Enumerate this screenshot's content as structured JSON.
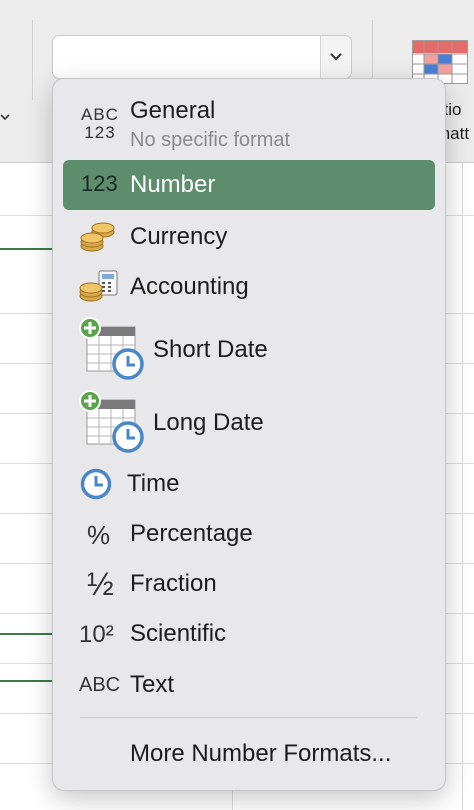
{
  "ribbon": {
    "format_combo_value": "",
    "conditional_formatting_label_line1": "litio",
    "conditional_formatting_label_line2": "matt"
  },
  "number_format_menu": {
    "items": [
      {
        "label": "General",
        "sub": "No specific format",
        "icon": "abc-123-icon",
        "icon_text": "ABC\n123"
      },
      {
        "label": "Number",
        "icon": "number-123-icon",
        "icon_text": "123",
        "selected": true
      },
      {
        "label": "Currency",
        "icon": "coins-icon"
      },
      {
        "label": "Accounting",
        "icon": "coins-calculator-icon"
      },
      {
        "label": "Short Date",
        "icon": "calendar-clock-icon"
      },
      {
        "label": "Long Date",
        "icon": "calendar-clock-icon"
      },
      {
        "label": "Time",
        "icon": "clock-icon"
      },
      {
        "label": "Percentage",
        "icon": "percent-icon",
        "icon_text": "%"
      },
      {
        "label": "Fraction",
        "icon": "fraction-icon",
        "icon_text": "½"
      },
      {
        "label": "Scientific",
        "icon": "scientific-icon",
        "icon_text": "10²"
      },
      {
        "label": "Text",
        "icon": "abc-icon",
        "icon_text": "ABC"
      }
    ],
    "more_label": "More Number Formats..."
  },
  "colors": {
    "selected_background": "#5d8d6d",
    "menu_background": "#e8e8ea",
    "clock_blue": "#4a87c9",
    "plus_green": "#5aa54b",
    "coin_gold": "#d9a84a"
  }
}
